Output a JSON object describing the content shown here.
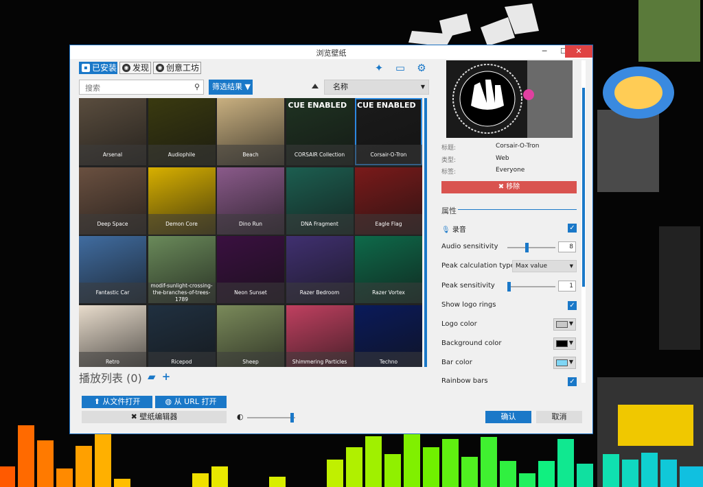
{
  "window": {
    "title": "浏览壁纸",
    "min": "─",
    "max": "☐",
    "close": "✕"
  },
  "tabs": [
    {
      "label": "已安装",
      "icon": "save-icon"
    },
    {
      "label": "发现",
      "icon": "compass-icon"
    },
    {
      "label": "创意工坊",
      "icon": "steam-icon"
    }
  ],
  "search": {
    "placeholder": "搜索"
  },
  "filter": {
    "label": "筛选结果"
  },
  "sort": {
    "value": "名称"
  },
  "wallpapers": [
    {
      "name": "Arsenal",
      "bg": "#5a4d3e"
    },
    {
      "name": "Audiophile",
      "bg": "#3a3a10"
    },
    {
      "name": "Beach",
      "bg": "#c9b080"
    },
    {
      "name": "CORSAIR Collection",
      "bg": "#1f3322",
      "cue": "CUE ENABLED"
    },
    {
      "name": "Corsair-O-Tron",
      "bg": "#1b1b1b",
      "cue": "CUE ENABLED",
      "selected": true
    },
    {
      "name": "Deep Space",
      "bg": "#6a5040"
    },
    {
      "name": "Demon Core",
      "bg": "#d8b000"
    },
    {
      "name": "Dino Run",
      "bg": "#8a5a8a"
    },
    {
      "name": "DNA Fragment",
      "bg": "#1c5e50"
    },
    {
      "name": "Eagle Flag",
      "bg": "#7a1a1a"
    },
    {
      "name": "Fantastic Car",
      "bg": "#406ca0"
    },
    {
      "name": "modif-sunlight-crossing-the-branches-of-trees-1789",
      "bg": "#6a8a5a"
    },
    {
      "name": "Neon Sunset",
      "bg": "#3a1040"
    },
    {
      "name": "Razer Bedroom",
      "bg": "#403070"
    },
    {
      "name": "Razer Vortex",
      "bg": "#0e6a4a"
    },
    {
      "name": "Retro",
      "bg": "#e8dccc"
    },
    {
      "name": "Ricepod",
      "bg": "#203040"
    },
    {
      "name": "Sheep",
      "bg": "#7a8a5a"
    },
    {
      "name": "Shimmering Particles",
      "bg": "#c04060"
    },
    {
      "name": "Techno",
      "bg": "#0a1a5a"
    }
  ],
  "playlist": {
    "label": "播放列表 (0)"
  },
  "buttons": {
    "open_file": "从文件打开",
    "open_url": "从 URL 打开",
    "editor": "壁纸编辑器",
    "ok": "确认",
    "cancel": "取消"
  },
  "details": {
    "title_label": "标题:",
    "title_value": "Corsair-O-Tron",
    "type_label": "类型:",
    "type_value": "Web",
    "rating_label": "标签:",
    "rating_value": "Everyone",
    "remove": "移除"
  },
  "properties": {
    "header": "属性",
    "record": "录音",
    "audio_sensitivity": {
      "label": "Audio sensitivity",
      "value": "8",
      "level": 0.4
    },
    "peak_type": {
      "label": "Peak calculation type",
      "value": "Max value"
    },
    "peak_sensitivity": {
      "label": "Peak sensitivity",
      "value": "1",
      "level": 0.0
    },
    "show_logo_rings": "Show logo rings",
    "logo_color": {
      "label": "Logo color",
      "color": "#c8c8c8"
    },
    "background_color": {
      "label": "Background color",
      "color": "#000000"
    },
    "bar_color": {
      "label": "Bar color",
      "color": "#7fd6f5"
    },
    "rainbow_bars": "Rainbow bars"
  },
  "brightness_level": 0.97,
  "colors": {
    "accent": "#1a78c8",
    "danger": "#d9534f"
  }
}
